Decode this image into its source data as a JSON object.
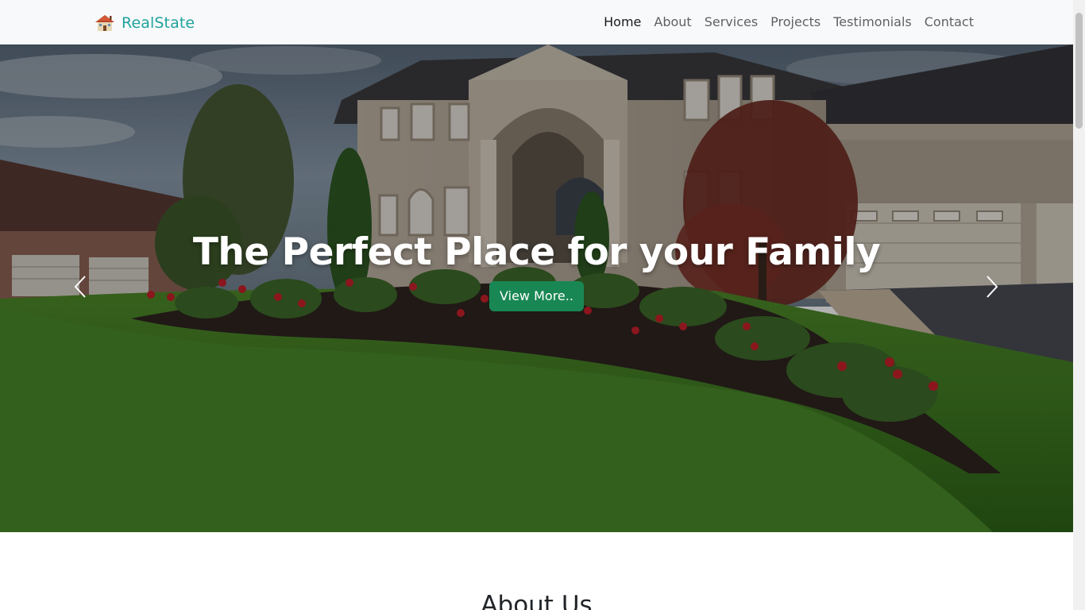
{
  "navbar": {
    "brand_name": "RealState",
    "brand_icon": "house-logo-icon",
    "links": [
      {
        "label": "Home",
        "active": true
      },
      {
        "label": "About",
        "active": false
      },
      {
        "label": "Services",
        "active": false
      },
      {
        "label": "Projects",
        "active": false
      },
      {
        "label": "Testimonials",
        "active": false
      },
      {
        "label": "Contact",
        "active": false
      }
    ]
  },
  "hero": {
    "title": "The Perfect Place for your Family",
    "button_label": "View More..",
    "prev_icon": "chevron-left-icon",
    "next_icon": "chevron-right-icon"
  },
  "about": {
    "title": "About Us"
  },
  "colors": {
    "brand": "#20a39e",
    "button": "#198754",
    "navbar_bg": "#f8f9fa"
  }
}
